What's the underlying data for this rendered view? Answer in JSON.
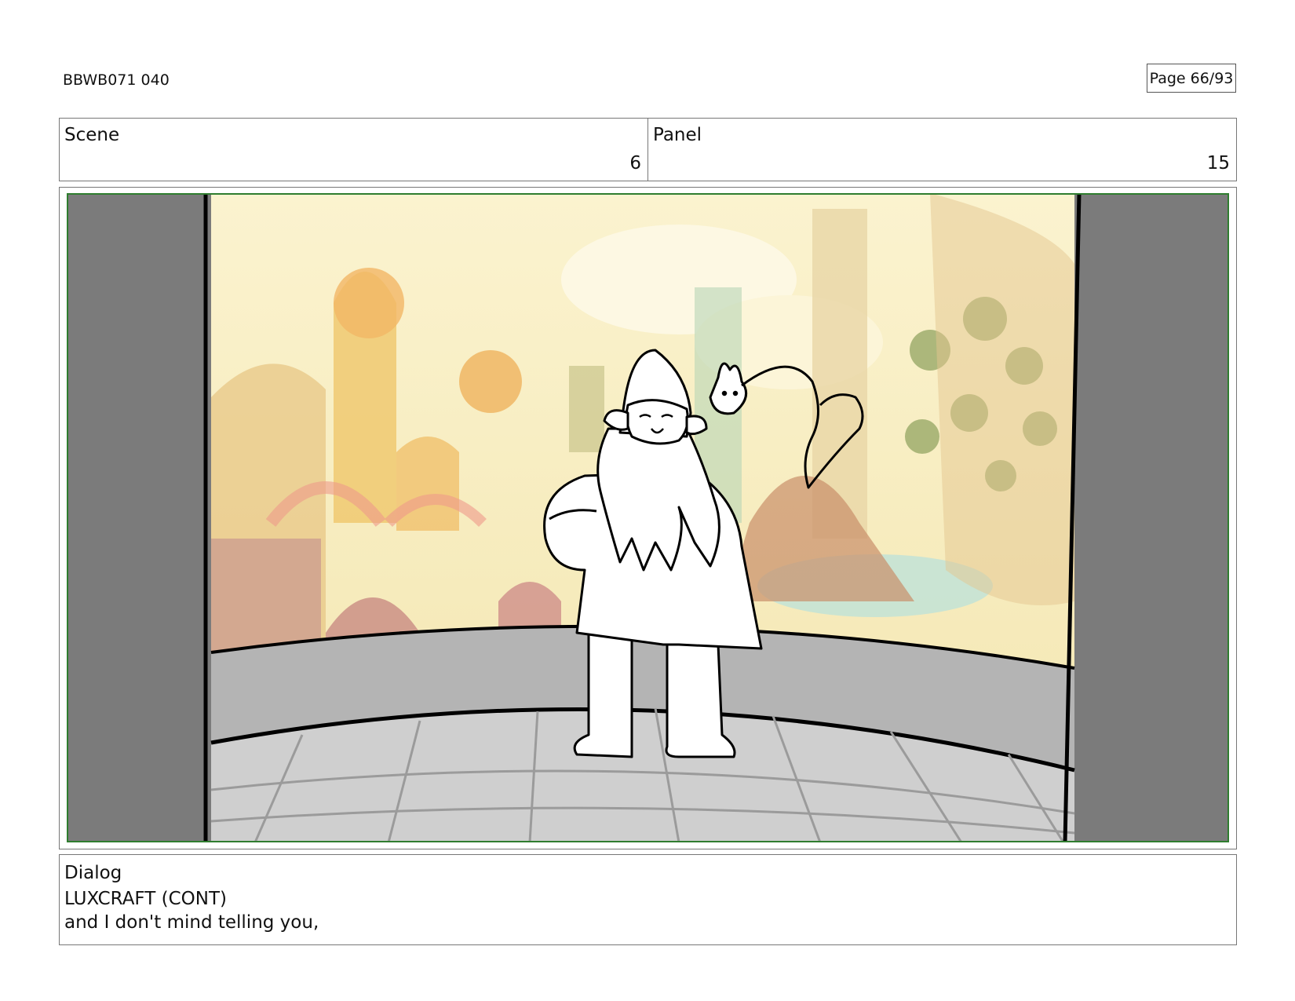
{
  "header": {
    "production_id": "BBWB071 040",
    "page": "Page 66/93"
  },
  "info": {
    "scene_label": "Scene",
    "scene_value": "6",
    "panel_label": "Panel",
    "panel_value": "15"
  },
  "panel": {
    "image_description_icon": "storyboard-drawing-icon",
    "colors": {
      "frame_green": "#2f7d2f",
      "side_gray": "#7b7b7b",
      "wall_gray": "#b4b4b4",
      "floor_gray": "#cfcfcf"
    }
  },
  "dialog": {
    "label": "Dialog",
    "character": "LUXCRAFT (CONT)",
    "line": "and I don't mind telling you,"
  }
}
